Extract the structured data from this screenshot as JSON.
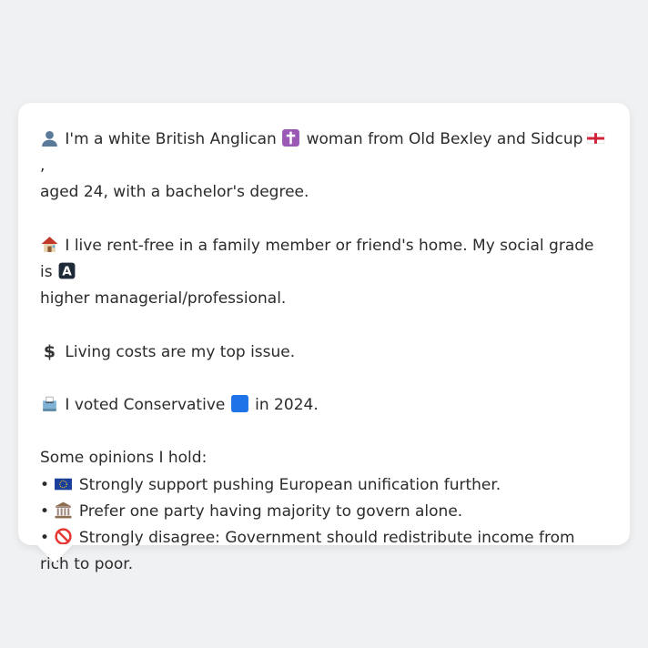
{
  "profile": {
    "line1": {
      "icon": "person-silhouette-icon",
      "t1": "I'm a white British Anglican",
      "icon_religion": "latin-cross-icon",
      "t2": "woman from Old Bexley and Sidcup",
      "icon_flag": "england-flag-icon",
      "t3": ",",
      "t4": "aged 24, with a bachelor's degree."
    },
    "line2": {
      "icon": "house-icon",
      "t1": "I live rent-free in a family member or friend's home. My social grade is",
      "icon_grade": "letter-a-button-icon",
      "t2": "higher managerial/professional."
    },
    "line3": {
      "icon": "dollar-sign-icon",
      "t1": "Living costs are my top issue."
    },
    "line4": {
      "icon": "ballot-box-icon",
      "t1": "I voted Conservative",
      "icon_party": "blue-square-icon",
      "t2": "in 2024."
    }
  },
  "opinions": {
    "heading": "Some opinions I hold:",
    "bullet": "•",
    "items": [
      {
        "icon": "eu-flag-icon",
        "text": "Strongly support pushing European unification further."
      },
      {
        "icon": "classical-building-icon",
        "text": "Prefer one party having majority to govern alone."
      },
      {
        "icon": "prohibited-icon",
        "text": "Strongly disagree: Government should redistribute income from rich to poor."
      }
    ]
  },
  "colors": {
    "background": "#f0f1f3",
    "card": "#ffffff",
    "text": "#2b2b2b",
    "conservative_blue": "#1e73e8"
  }
}
